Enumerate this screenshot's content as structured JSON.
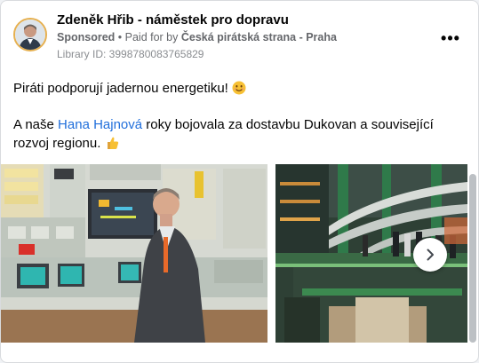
{
  "post": {
    "author": "Zdeněk Hřib - náměstek pro dopravu",
    "sponsored_label": "Sponsored",
    "separator": " • ",
    "paid_prefix": "Paid for by ",
    "payer": "Česká pirátská strana - Praha",
    "library_id": "Library ID: 3998780083765829",
    "more_label": "•••",
    "line1": "Piráti podporují jadernou energetiku!",
    "line2_before": "A naše ",
    "line2_link": "Hana Hajnová",
    "line2_after": " roky bojovala za dostavbu Dukovan a související rozvoj regionu.",
    "emoji1": "smiling-face-emoji",
    "emoji2": "thumbs-up-emoji"
  },
  "media": {
    "image1": "control-room-photo",
    "image2": "turbine-hall-photo",
    "next_icon": "chevron-right-icon"
  },
  "colors": {
    "link": "#216fdb",
    "text": "#050505",
    "secondary": "#65676b"
  }
}
